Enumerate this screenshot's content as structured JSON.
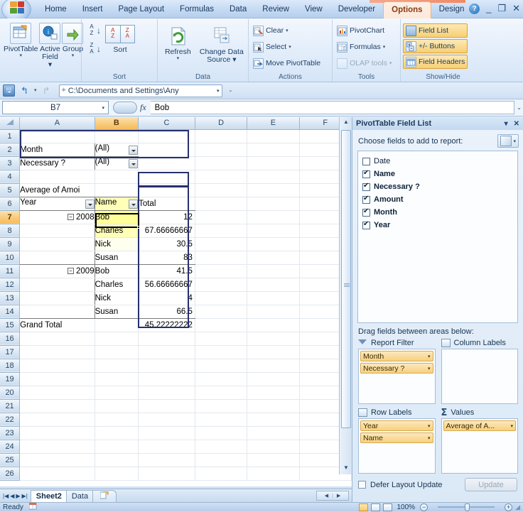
{
  "window": {
    "tabs": [
      "Home",
      "Insert",
      "Page Layout",
      "Formulas",
      "Data",
      "Review",
      "View",
      "Developer",
      "Options",
      "Design"
    ],
    "active_tab": "Options",
    "help_glyph": "?",
    "minimize_glyph": "_",
    "restore_glyph": "❐",
    "close_glyph": "✕"
  },
  "ribbon": {
    "groups": [
      {
        "title": "",
        "big_buttons": [
          {
            "label_line1": "PivotTable",
            "label_line2": "",
            "has_caret": true
          },
          {
            "label_line1": "Active",
            "label_line2": "Field",
            "has_caret": true
          },
          {
            "label_line1": "Group",
            "label_line2": "",
            "has_caret": true
          }
        ]
      },
      {
        "title": "Sort",
        "items": [
          "Sort"
        ]
      },
      {
        "title": "Data",
        "items": [
          "Refresh",
          "Change Data Source"
        ]
      },
      {
        "title": "Actions",
        "items": [
          "Clear",
          "Select",
          "Move PivotTable"
        ]
      },
      {
        "title": "Tools",
        "items": [
          "PivotChart",
          "Formulas",
          "OLAP tools"
        ]
      },
      {
        "title": "Show/Hide",
        "items": [
          "Field List",
          "+/- Buttons",
          "Field Headers"
        ]
      }
    ],
    "sort_az": "A\nZ",
    "sort_za": "Z\nA",
    "sort_label": "Sort",
    "refresh_label": "Refresh",
    "change_source_line1": "Change Data",
    "change_source_line2": "Source",
    "clear_label": "Clear",
    "select_label": "Select",
    "move_pivot_label": "Move PivotTable",
    "pivotchart_label": "PivotChart",
    "formulas_label": "Formulas",
    "olap_label": "OLAP tools",
    "fieldlist_label": "Field List",
    "pmbuttons_label": "+/- Buttons",
    "fieldheaders_label": "Field Headers",
    "data_title": "Data",
    "sort_title": "Sort",
    "actions_title": "Actions",
    "tools_title": "Tools",
    "showhide_title": "Show/Hide"
  },
  "qat": {
    "save_glyph": "🖫",
    "undo_glyph": "↰",
    "redo_glyph": "↱",
    "path_value": "C:\\Documents and Settings\\Any",
    "more_glyph": "⌄"
  },
  "formula_bar": {
    "name_box": "B7",
    "fx_label": "fx",
    "content": "Bob",
    "expand_glyph": "⌄"
  },
  "grid": {
    "columns": [
      "A",
      "B",
      "C",
      "D",
      "E",
      "F"
    ],
    "selected_column": "B",
    "selected_row": "7",
    "rows": [
      "1",
      "2",
      "3",
      "4",
      "5",
      "6",
      "7",
      "8",
      "9",
      "10",
      "11",
      "12",
      "13",
      "14",
      "15",
      "16",
      "17",
      "18",
      "19",
      "20",
      "21",
      "22",
      "23",
      "24",
      "25",
      "26"
    ],
    "cells": {
      "A2": "Month",
      "B2": "(All)",
      "A3": "Necessary ?",
      "B3": "(All)",
      "A5": "Average of Amoi",
      "A6": "Year",
      "B6": "Name",
      "C6": "Total",
      "A7": "2008",
      "B7": "Bob",
      "C7": "12",
      "B8": "Charles",
      "C8": "67.66666667",
      "B9": "Nick",
      "C9": "30.5",
      "B10": "Susan",
      "C10": "83",
      "A11": "2009",
      "B11": "Bob",
      "C11": "41.5",
      "B12": "Charles",
      "C12": "56.66666667",
      "B13": "Nick",
      "C13": "4",
      "B14": "Susan",
      "C14": "66.5",
      "A15": "Grand Total",
      "C15": "45.22222222"
    },
    "collapse_glyph": "−"
  },
  "sheet_tabs": {
    "tabs": [
      "Sheet2",
      "Data"
    ],
    "active": "Sheet2",
    "first_glyph": "|◀",
    "prev_glyph": "◀",
    "next_glyph": "▶",
    "last_glyph": "▶|"
  },
  "status_bar": {
    "state": "Ready",
    "zoom": "100%",
    "zoom_out_glyph": "−",
    "zoom_in_glyph": "+"
  },
  "field_list": {
    "title": "PivotTable Field List",
    "menu_glyph": "▾",
    "close_glyph": "✕",
    "choose_label": "Choose fields to add to report:",
    "fields": [
      {
        "label": "Date",
        "checked": false
      },
      {
        "label": "Name",
        "checked": true
      },
      {
        "label": "Necessary ?",
        "checked": true
      },
      {
        "label": "Amount",
        "checked": true
      },
      {
        "label": "Month",
        "checked": true
      },
      {
        "label": "Year",
        "checked": true
      }
    ],
    "drag_label": "Drag fields between areas below:",
    "areas": [
      {
        "name": "Report Filter",
        "pills": [
          "Month",
          "Necessary ?"
        ]
      },
      {
        "name": "Column Labels",
        "pills": []
      },
      {
        "name": "Row Labels",
        "pills": [
          "Year",
          "Name"
        ]
      },
      {
        "name": "Values",
        "pills": [
          "Average of A..."
        ]
      }
    ],
    "defer_label": "Defer Layout Update",
    "update_label": "Update",
    "pill_caret": "▾"
  },
  "colors": {
    "accent_orange": "#f5bc5c",
    "selection_blue": "#26306e",
    "highlight_yellow": "#ffff99",
    "pill_gold": "#f6d081"
  }
}
